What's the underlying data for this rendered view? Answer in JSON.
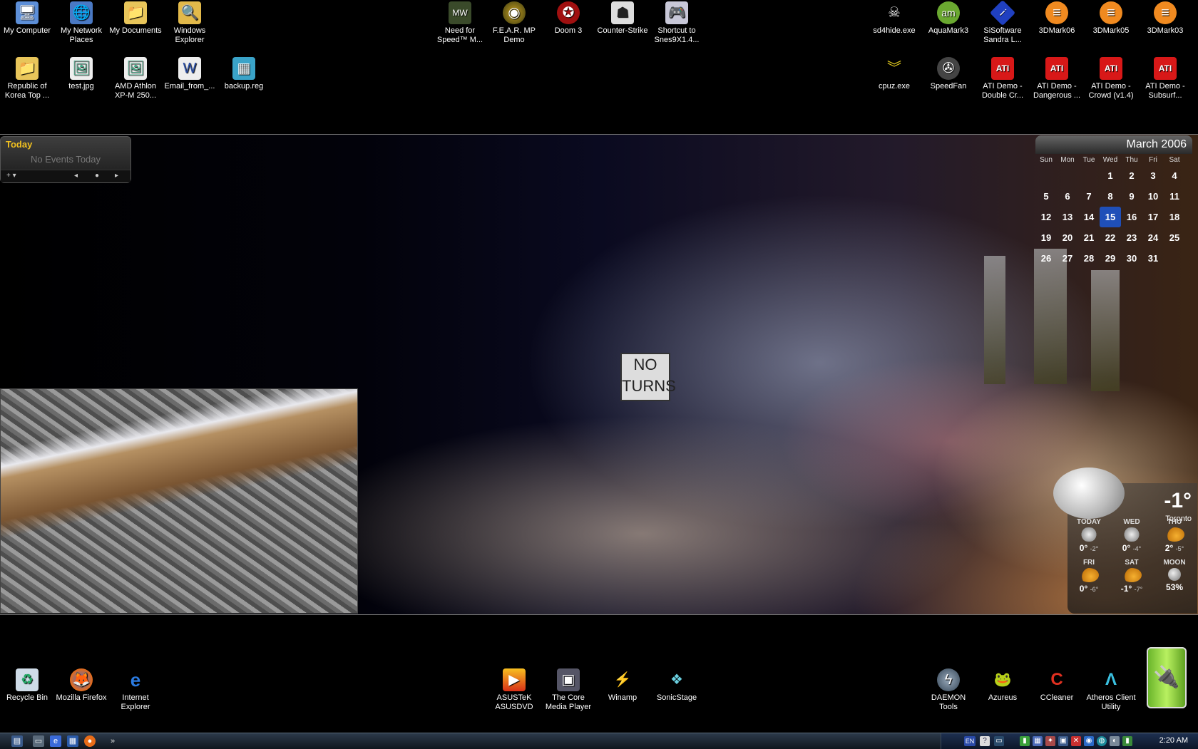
{
  "desktop_icons": {
    "my_computer": "My Computer",
    "my_network_places": "My Network Places",
    "my_documents": "My Documents",
    "windows_explorer": "Windows Explorer",
    "need_for_speed": "Need for Speed™ M...",
    "fear_mp_demo": "F.E.A.R. MP Demo",
    "doom3": "Doom 3",
    "counter_strike": "Counter-Strike",
    "snes9x": "Shortcut to Snes9X1.4...",
    "sd4hide": "sd4hide.exe",
    "aquamark3": "AquaMark3",
    "sisoftware": "SiSoftware Sandra L...",
    "3dmark06": "3DMark06",
    "3dmark05": "3DMark05",
    "3dmark03": "3DMark03",
    "republic_of_korea": "Republic of Korea Top ...",
    "test_jpg": "test.jpg",
    "amd_athlon": "AMD Athlon XP-M 250...",
    "email_from": "Email_from_...",
    "backup_reg": "backup.reg",
    "cpuz": "cpuz.exe",
    "speedfan": "SpeedFan",
    "ati_double": "ATI Demo - Double Cr...",
    "ati_dangerous": "ATI Demo - Dangerous ...",
    "ati_crowd": "ATI Demo - Crowd (v1.4)",
    "ati_subsurf": "ATI Demo - Subsurf...",
    "recycle_bin": "Recycle Bin",
    "firefox": "Mozilla Firefox",
    "internet_explorer": "Internet Explorer",
    "asus_dvd": "ASUSTeK ASUSDVD",
    "core_media_player": "The Core Media Player",
    "winamp": "Winamp",
    "sonicstage": "SonicStage",
    "daemon_tools": "DAEMON Tools",
    "azureus": "Azureus",
    "ccleaner": "CCleaner",
    "atheros": "Atheros Client Utility"
  },
  "today_widget": {
    "title": "Today",
    "events": "No Events Today",
    "add": "+ ▾",
    "prev": "◂",
    "home": "●",
    "next": "▸"
  },
  "calendar": {
    "title": "March 2006",
    "weekdays": [
      "Sun",
      "Mon",
      "Tue",
      "Wed",
      "Thu",
      "Fri",
      "Sat"
    ],
    "weeks": [
      [
        "",
        "",
        "",
        "1",
        "2",
        "3",
        "4"
      ],
      [
        "5",
        "6",
        "7",
        "8",
        "9",
        "10",
        "11"
      ],
      [
        "12",
        "13",
        "14",
        "15",
        "16",
        "17",
        "18"
      ],
      [
        "19",
        "20",
        "21",
        "22",
        "23",
        "24",
        "25"
      ],
      [
        "26",
        "27",
        "28",
        "29",
        "30",
        "31",
        ""
      ]
    ],
    "today": "15",
    "highlight_color": "#1f4fb8"
  },
  "weather": {
    "current_temp": "-1°",
    "city": "Toronto",
    "forecast": [
      {
        "day": "TODAY",
        "high": "0°",
        "low": "-2°",
        "icon": "snow-icon"
      },
      {
        "day": "WED",
        "high": "0°",
        "low": "-4°",
        "icon": "snow-icon"
      },
      {
        "day": "THU",
        "high": "2°",
        "low": "-5°",
        "icon": "sun-cloud-icon"
      },
      {
        "day": "FRI",
        "high": "0°",
        "low": "-6°",
        "icon": "sun-cloud-icon"
      },
      {
        "day": "SAT",
        "high": "-1°",
        "low": "-7°",
        "icon": "sun-cloud-icon"
      },
      {
        "day": "MOON",
        "high": "53%",
        "low": "",
        "icon": "moon-icon"
      }
    ]
  },
  "wallpaper": {
    "sign_text": "NO TURNS"
  },
  "taskbar": {
    "language": "EN",
    "clock": "2:20 AM",
    "chevron": "»"
  }
}
